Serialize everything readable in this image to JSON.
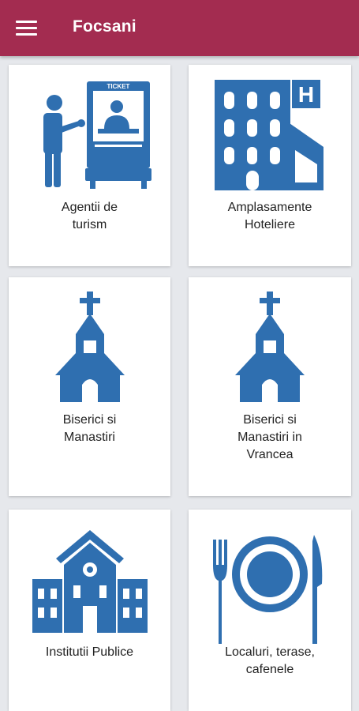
{
  "appbar": {
    "title": "Focsani",
    "menu_icon": "hamburger-menu-icon"
  },
  "colors": {
    "appbar": "#a32c50",
    "icon": "#2f6fb0",
    "background": "#e6e8ec",
    "card": "#ffffff",
    "text": "#222222"
  },
  "categories": [
    {
      "label": "Agentii de\nturism",
      "icon": "travel-agency-icon",
      "sign_text": "TICKET"
    },
    {
      "label": "Amplasamente\nHoteliere",
      "icon": "hotel-icon",
      "sign_text": "H"
    },
    {
      "label": "Biserici si\nManastiri",
      "icon": "church-icon"
    },
    {
      "label": "Biserici si\nManastiri in\nVrancea",
      "icon": "church-icon"
    },
    {
      "label": "Institutii Publice",
      "icon": "public-institution-icon"
    },
    {
      "label": "Localuri, terase,\ncafenele",
      "icon": "restaurant-icon"
    }
  ]
}
